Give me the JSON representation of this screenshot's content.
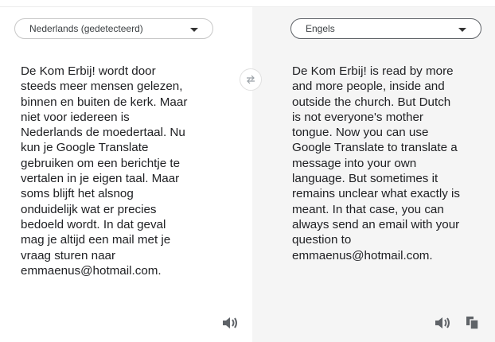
{
  "source": {
    "language_label": "Nederlands (gedetecteerd)",
    "text": "De Kom Erbij! wordt door\nsteeds meer mensen gelezen,\nbinnen en buiten de kerk. Maar\nniet voor iedereen is\nNederlands de moedertaal. Nu\nkun je Google Translate\ngebruiken om een berichtje te\nvertalen in je eigen taal. Maar\nsoms blijft het alsnog\nonduidelijk wat er precies\nbedoeld wordt. In dat geval\nmag je altijd een mail met je\nvraag sturen naar\nemmaenus@hotmail.com.",
    "listen_icon": "speaker-icon"
  },
  "target": {
    "language_label": "Engels",
    "text": "De Kom Erbij! is read by more\nand more people, inside and\noutside the church. But Dutch\nis not everyone's mother\ntongue. Now you can use\nGoogle Translate to translate a\nmessage into your own\nlanguage. But sometimes it\nremains unclear what exactly is\nmeant. In that case, you can\nalways send an email with your\nquestion to\nemmaenus@hotmail.com.",
    "listen_icon": "speaker-icon",
    "copy_icon": "copy-icon"
  },
  "swap_icon": "swap-arrows-icon",
  "colors": {
    "right_panel_bg": "#f5f5f5",
    "text": "#202124",
    "icon": "#5f6368"
  }
}
